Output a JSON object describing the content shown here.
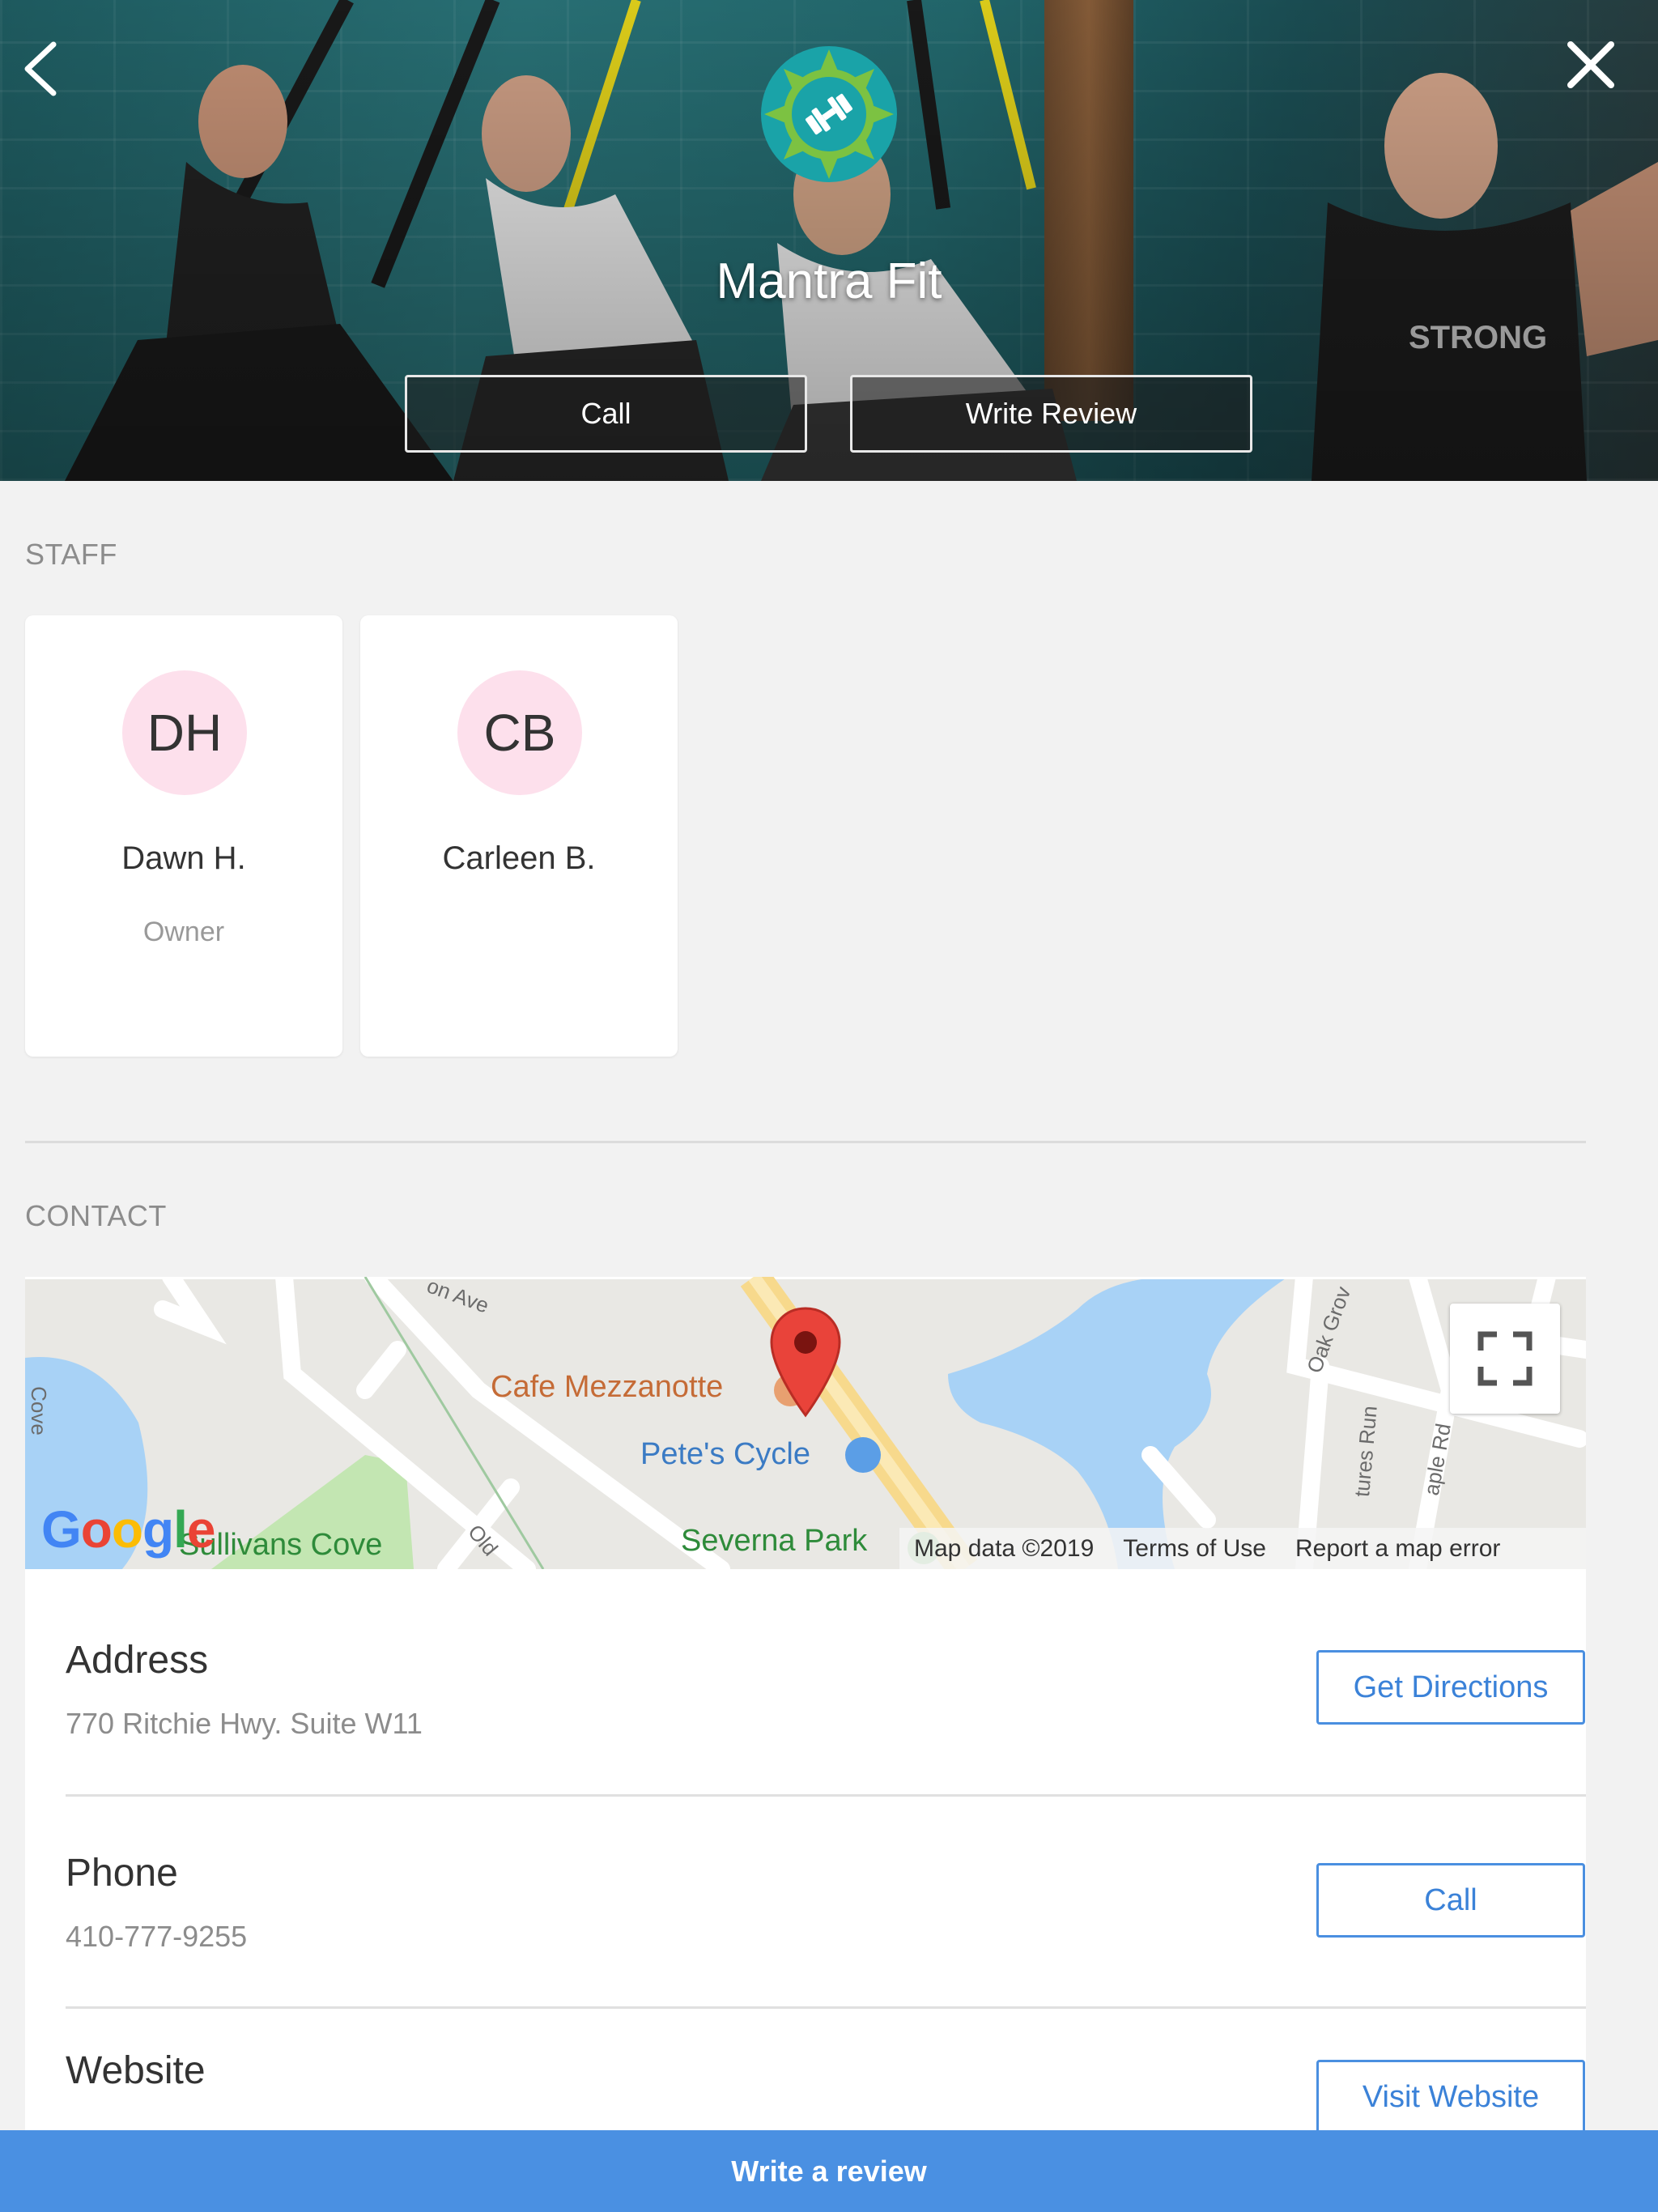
{
  "header": {
    "business_name": "Mantra Fit",
    "call_label": "Call",
    "write_review_label": "Write Review"
  },
  "icons": {
    "back": "chevron-left-icon",
    "close": "close-icon",
    "logo": "dumbbell-logo",
    "fullscreen": "fullscreen-icon",
    "map_pin": "map-pin-icon"
  },
  "staff": {
    "title": "STAFF",
    "members": [
      {
        "initials": "DH",
        "name": "Dawn H.",
        "role": "Owner"
      },
      {
        "initials": "CB",
        "name": "Carleen B.",
        "role": ""
      }
    ]
  },
  "contact": {
    "title": "CONTACT",
    "map": {
      "labels": {
        "cafe": "Cafe Mezzanotte",
        "cycle": "Pete's Cycle",
        "sullivans": "Sullivans Cove",
        "severna": "Severna Park",
        "old": "Old",
        "on_ave": "on Ave",
        "oak": "Oak Grov",
        "ures_run": "tures Run",
        "aple_rd": "aple Rd",
        "cove": "Cove"
      },
      "google": "Google",
      "attribution": [
        "Map data ©2019",
        "Terms of Use",
        "Report a map error"
      ]
    },
    "rows": [
      {
        "label": "Address",
        "value": "770 Ritchie Hwy. Suite W11",
        "action": "Get Directions"
      },
      {
        "label": "Phone",
        "value": "410-777-9255",
        "action": "Call"
      },
      {
        "label": "Website",
        "value": "",
        "action": "Visit Website"
      }
    ]
  },
  "footer": {
    "cta": "Write a review"
  },
  "colors": {
    "accent": "#4a90e2",
    "avatar_bg": "#fde0ec",
    "logo_green": "#7cc242",
    "logo_teal": "#1aa3a8"
  }
}
